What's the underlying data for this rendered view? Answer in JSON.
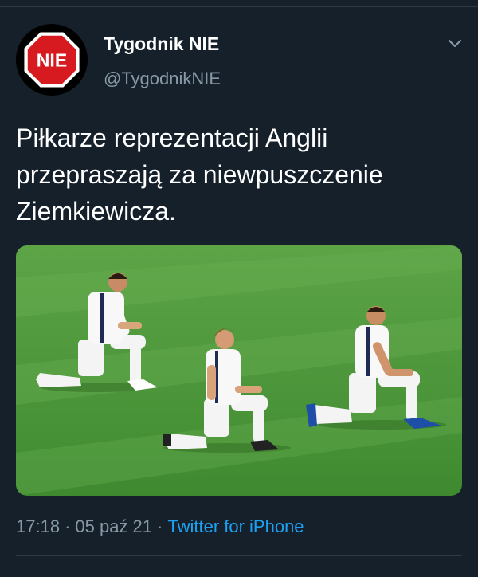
{
  "tweet": {
    "author_name": "Tygodnik NIE",
    "author_handle": "@TygodnikNIE",
    "avatar_logo_text": "NIE",
    "text": "Piłkarze reprezentacji Anglii\nprzepraszają za niewpuszczenie\nZiemkiewicza.",
    "time": "17:18",
    "date": "05 paź 21",
    "separator": "·",
    "source": "Twitter for iPhone",
    "media": {
      "type": "photo",
      "icon": "photo-of-kneeling-football-players"
    }
  },
  "icons": {
    "menu": "chevron-down-icon",
    "avatar": "stop-sign-logo"
  },
  "colors": {
    "background": "#15202b",
    "secondary_text": "#8899a6",
    "link": "#1da1f2",
    "pitch": "#4e9a3a"
  }
}
